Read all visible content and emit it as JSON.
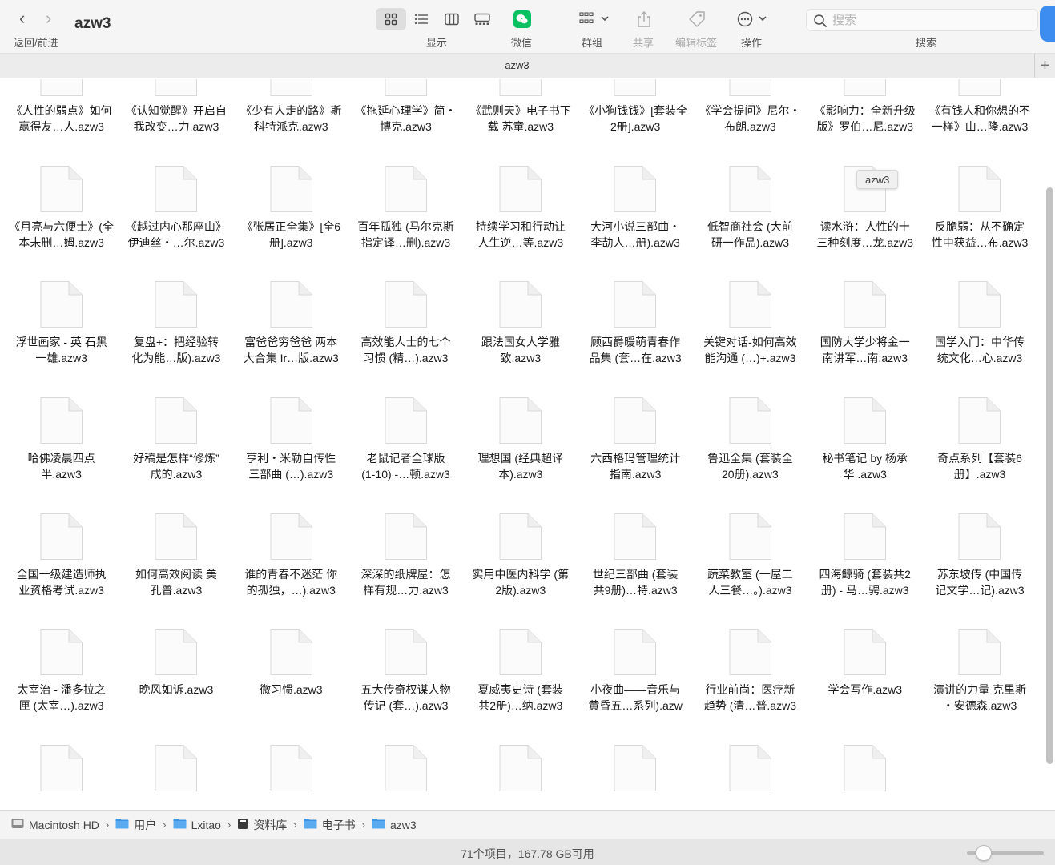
{
  "window": {
    "title": "azw3"
  },
  "toolbar": {
    "nav_label": "返回/前进",
    "view_label": "显示",
    "wechat_label": "微信",
    "group_label": "群组",
    "share_label": "共享",
    "tags_label": "编辑标签",
    "action_label": "操作",
    "search_label": "搜索",
    "search_placeholder": "搜索"
  },
  "tab": {
    "title": "azw3",
    "tooltip": "azw3"
  },
  "files": [
    [
      "《人性的弱点》如何",
      "赢得友…人.azw3"
    ],
    [
      "《认知觉醒》开启自",
      "我改变…力.azw3"
    ],
    [
      "《少有人走的路》斯",
      "科特派克.azw3"
    ],
    [
      "《拖延心理学》简・",
      "博克.azw3"
    ],
    [
      "《武则天》电子书下",
      "载 苏童.azw3"
    ],
    [
      "《小狗钱钱》[套装全",
      "2册].azw3"
    ],
    [
      "《学会提问》尼尔・",
      "布朗.azw3"
    ],
    [
      "《影响力：全新升级",
      "版》罗伯…尼.azw3"
    ],
    [
      "《有钱人和你想的不",
      "一样》山…隆.azw3"
    ],
    [
      "《月亮与六便士》(全",
      "本未删…姆.azw3"
    ],
    [
      "《越过内心那座山》",
      "伊迪丝・…尔.azw3"
    ],
    [
      "《张居正全集》[全6",
      "册].azw3"
    ],
    [
      "百年孤独 (马尔克斯",
      "指定译…删).azw3"
    ],
    [
      "持续学习和行动让",
      "人生逆…等.azw3"
    ],
    [
      "大河小说三部曲・",
      "李劼人…册).azw3"
    ],
    [
      "低智商社会 (大前",
      "研一作品).azw3"
    ],
    [
      "读水浒：人性的十",
      "三种刻度…龙.azw3"
    ],
    [
      "反脆弱：从不确定",
      "性中获益…布.azw3"
    ],
    [
      "浮世画家 - 英 石黑",
      "一雄.azw3"
    ],
    [
      "复盘+：把经验转",
      "化为能…版).azw3"
    ],
    [
      "富爸爸穷爸爸 两本",
      "大合集 Ir…版.azw3"
    ],
    [
      "高效能人士的七个",
      "习惯 (精…).azw3"
    ],
    [
      "跟法国女人学雅",
      "致.azw3"
    ],
    [
      "顾西爵暖萌青春作",
      "品集 (套…在.azw3"
    ],
    [
      "关键对话-如何高效",
      "能沟通 (…)+.azw3"
    ],
    [
      "国防大学少将金一",
      "南讲军…南.azw3"
    ],
    [
      "国学入门：中华传",
      "统文化…心.azw3"
    ],
    [
      "哈佛凌晨四点",
      "半.azw3"
    ],
    [
      "好稿是怎样“修炼”",
      "成的.azw3"
    ],
    [
      "亨利・米勒自传性",
      "三部曲 (…).azw3"
    ],
    [
      "老鼠记者全球版",
      "(1-10) -…顿.azw3"
    ],
    [
      "理想国 (经典超译",
      "本).azw3"
    ],
    [
      "六西格玛管理统计",
      "指南.azw3"
    ],
    [
      "鲁迅全集 (套装全",
      "20册).azw3"
    ],
    [
      "秘书笔记 by 杨承",
      "华 .azw3"
    ],
    [
      "奇点系列【套装6",
      "册】.azw3"
    ],
    [
      "全国一级建造师执",
      "业资格考试.azw3"
    ],
    [
      "如何高效阅读 美",
      "孔普.azw3"
    ],
    [
      "谁的青春不迷茫 你",
      "的孤独，…).azw3"
    ],
    [
      "深深的纸牌屋：怎",
      "样有规…力.azw3"
    ],
    [
      "实用中医内科学 (第",
      "2版).azw3"
    ],
    [
      "世纪三部曲 (套装",
      "共9册)…特.azw3"
    ],
    [
      "蔬菜教室 (一屋二",
      "人三餐…。).azw3"
    ],
    [
      "四海鲸骑 (套装共2",
      "册) - 马…骋.azw3"
    ],
    [
      "苏东坡传 (中国传",
      "记文学…记).azw3"
    ],
    [
      "太宰治 - 潘多拉之",
      "匣 (太宰…).azw3"
    ],
    [
      "晚风如诉.azw3",
      ""
    ],
    [
      "微习惯.azw3",
      ""
    ],
    [
      "五大传奇权谋人物",
      "传记 (套…).azw3"
    ],
    [
      "夏威夷史诗 (套装",
      "共2册)…纳.azw3"
    ],
    [
      "小夜曲——音乐与",
      "黄昏五…系列).azw"
    ],
    [
      "行业前尚：医疗新",
      "趋势 (清…普.azw3"
    ],
    [
      "学会写作.azw3",
      ""
    ],
    [
      "演讲的力量 克里斯",
      "・安德森.azw3"
    ],
    [
      "",
      ""
    ],
    [
      "",
      ""
    ],
    [
      "",
      ""
    ],
    [
      "",
      ""
    ],
    [
      "",
      ""
    ],
    [
      "",
      ""
    ],
    [
      "",
      ""
    ],
    [
      "",
      ""
    ]
  ],
  "pathbar": {
    "crumbs": [
      "Macintosh HD",
      "用户",
      "Lxitao",
      "资料库",
      "电子书",
      "azw3"
    ],
    "separator": "›"
  },
  "status": {
    "text": "71个项目，167.78 GB可用"
  },
  "icon_zoom": 0.2,
  "colors": {
    "folder": "#3b93e4",
    "accent": "#3d8cf0",
    "wechat": "#09c160"
  }
}
